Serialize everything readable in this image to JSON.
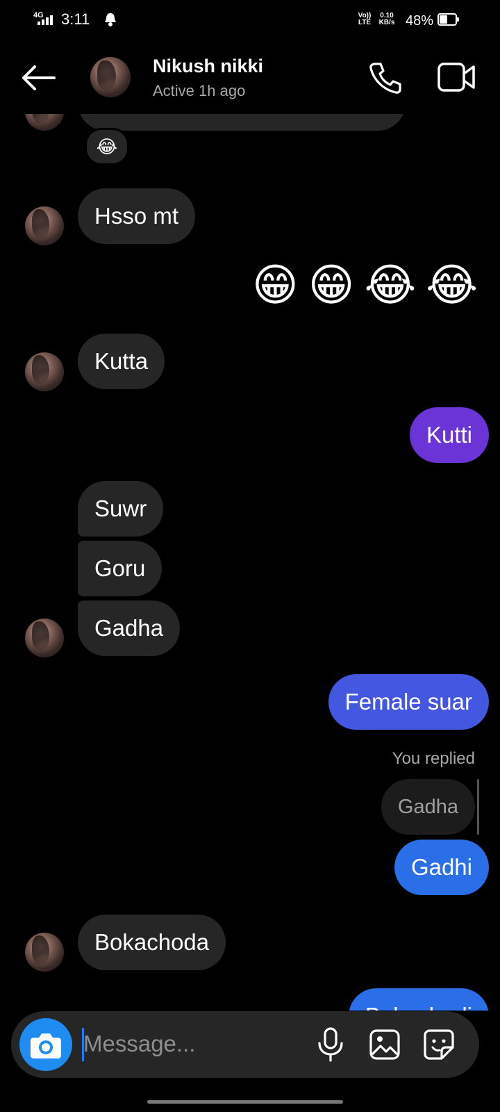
{
  "status_bar": {
    "network_type": "4G",
    "time": "3:11",
    "volte_top": "Vo))",
    "volte_bottom": "LTE",
    "speed_value": "0.10",
    "speed_unit": "KB/s",
    "battery": "48%",
    "battery_level": 0.48
  },
  "header": {
    "name": "Nikush nikki",
    "status": "Active 1h ago"
  },
  "messages": {
    "reaction_emoji": "😂",
    "m1": "Hsso mt",
    "emoji_row": [
      "😁",
      "😁",
      "😂",
      "😂"
    ],
    "m2": "Kutta",
    "m3": "Kutti",
    "m4": "Suwr",
    "m5": "Goru",
    "m6": "Gadha",
    "m7": "Female suar",
    "reply_label": "You replied",
    "reply_quote": "Gadha",
    "m8": "Gadhi",
    "m9": "Bokachoda",
    "m10": "Bokachodi"
  },
  "composer": {
    "placeholder": "Message..."
  },
  "colors": {
    "background": "#000000",
    "incoming_bubble": "#262626",
    "outgoing_purple": "#6b34d6",
    "outgoing_indigo": "#4357e0",
    "outgoing_blue": "#2a6fe8",
    "camera_button": "#1e8cf0"
  },
  "icons": [
    "back-arrow-icon",
    "phone-icon",
    "video-camera-icon",
    "camera-icon",
    "microphone-icon",
    "gallery-icon",
    "sticker-icon"
  ]
}
